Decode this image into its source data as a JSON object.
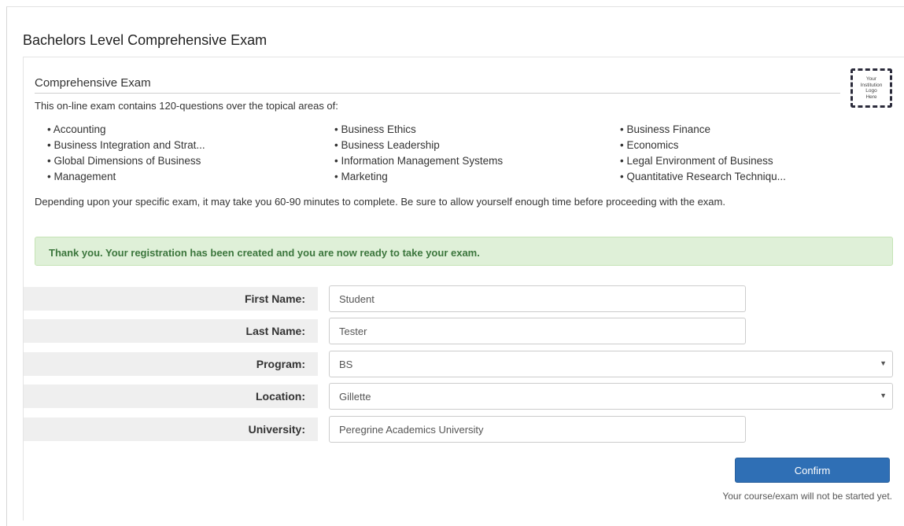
{
  "page": {
    "title": "Bachelors Level Comprehensive Exam"
  },
  "section": {
    "heading": "Comprehensive Exam",
    "logo_text": "Your\nInstitution\nLogo\nHere",
    "intro": "This on-line exam contains 120-questions over the topical areas of:",
    "topics": [
      "Accounting",
      "Business Ethics",
      "Business Finance",
      "Business Integration and Strat...",
      "Business Leadership",
      "Economics",
      "Global Dimensions of Business",
      "Information Management Systems",
      "Legal Environment of Business",
      "Management",
      "Marketing",
      "Quantitative Research Techniqu..."
    ],
    "duration_note": "Depending upon your specific exam, it may take you 60-90 minutes to complete. Be sure to allow yourself enough time before proceeding with the exam."
  },
  "alert": {
    "message": "Thank you. Your registration has been created and you are now ready to take your exam."
  },
  "form": {
    "first_name": {
      "label": "First Name:",
      "value": "Student"
    },
    "last_name": {
      "label": "Last Name:",
      "value": "Tester"
    },
    "program": {
      "label": "Program:",
      "value": "BS"
    },
    "location": {
      "label": "Location:",
      "value": "Gillette"
    },
    "university": {
      "label": "University:",
      "value": "Peregrine Academics University"
    }
  },
  "actions": {
    "confirm_label": "Confirm",
    "note": "Your course/exam will not be started yet."
  },
  "colors": {
    "primary": "#2f6fb5",
    "success_bg": "#dff0d8",
    "success_text": "#3c763d",
    "label_bg": "#efefef"
  }
}
